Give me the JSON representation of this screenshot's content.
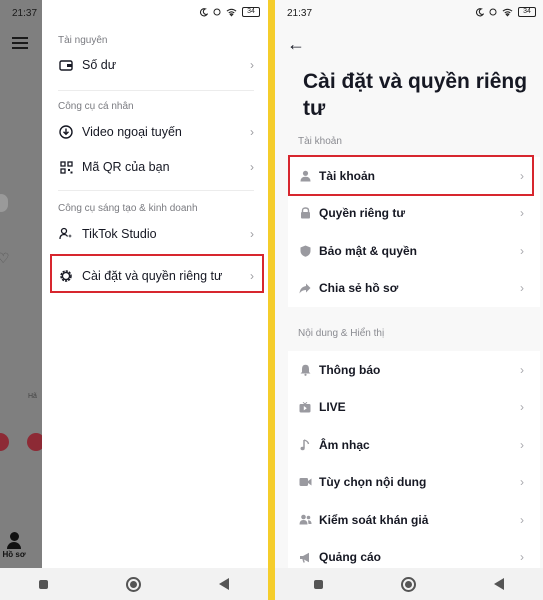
{
  "left": {
    "status_time": "21:37",
    "battery": "34",
    "bottom_tab_label": "Hồ sơ",
    "partial_text": "Hã",
    "sections": [
      {
        "title": "Tài nguyên",
        "items": [
          {
            "label": "Số dư",
            "icon": "wallet-icon"
          }
        ]
      },
      {
        "title": "Công cụ cá nhân",
        "items": [
          {
            "label": "Video ngoại tuyến",
            "icon": "download-icon"
          },
          {
            "label": "Mã QR của bạn",
            "icon": "qr-code-icon"
          }
        ]
      },
      {
        "title": "Công cụ sáng tạo & kinh doanh",
        "items": [
          {
            "label": "TikTok Studio",
            "icon": "creator-icon"
          },
          {
            "label": "Cài đặt và quyền riêng tư",
            "icon": "settings-gear-icon"
          }
        ]
      }
    ]
  },
  "right": {
    "status_time": "21:37",
    "battery": "34",
    "page_title": "Cài đặt và quyền riêng tư",
    "sections": [
      {
        "title": "Tài khoản",
        "items": [
          {
            "label": "Tài khoản",
            "icon": "person-icon"
          },
          {
            "label": "Quyền riêng tư",
            "icon": "lock-icon"
          },
          {
            "label": "Bảo mật & quyền",
            "icon": "shield-icon"
          },
          {
            "label": "Chia sẻ hồ sơ",
            "icon": "share-icon"
          }
        ]
      },
      {
        "title": "Nội dung & Hiển thị",
        "items": [
          {
            "label": "Thông báo",
            "icon": "bell-icon"
          },
          {
            "label": "LIVE",
            "icon": "live-tv-icon"
          },
          {
            "label": "Âm nhạc",
            "icon": "music-note-icon"
          },
          {
            "label": "Tùy chọn nội dung",
            "icon": "video-camera-icon"
          },
          {
            "label": "Kiểm soát khán giả",
            "icon": "audience-icon"
          },
          {
            "label": "Quảng cáo",
            "icon": "megaphone-icon"
          }
        ]
      }
    ]
  },
  "colors": {
    "highlight": "#d7262e",
    "separator": "#f5cd2b"
  }
}
